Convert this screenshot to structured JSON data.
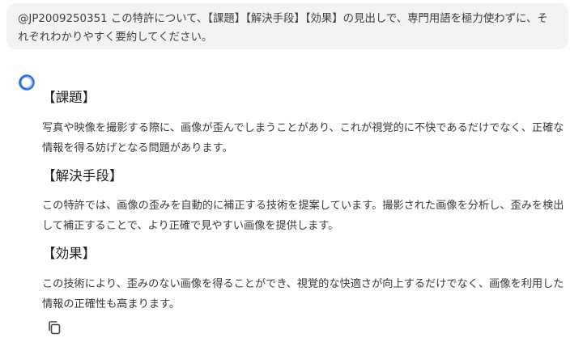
{
  "user_message": {
    "text": "@JP2009250351 この特許について、【課題】【解決手段】【効果】の見出しで、専門用語を極力使わずに、それぞれわかりやすく要約してください。"
  },
  "assistant": {
    "sections": [
      {
        "heading": "【課題】",
        "body": "写真や映像を撮影する際に、画像が歪んでしまうことがあり、これが視覚的に不快であるだけでなく、正確な情報を得る妨げとなる問題があります。"
      },
      {
        "heading": "【解決手段】",
        "body": "この特許では、画像の歪みを自動的に補正する技術を提案しています。撮影された画像を分析し、歪みを検出して補正することで、より正確で見やすい画像を提供します。"
      },
      {
        "heading": "【効果】",
        "body": "この技術により、歪みのない画像を得ることができ、視覚的な快適さが向上するだけでなく、画像を利用した情報の正確性も高まります。"
      }
    ]
  },
  "icons": {
    "avatar": "assistant-logo-icon",
    "copy": "copy-icon"
  },
  "colors": {
    "bubble_bg": "#f1f3f5",
    "avatar_blue": "#2f6fe4"
  }
}
